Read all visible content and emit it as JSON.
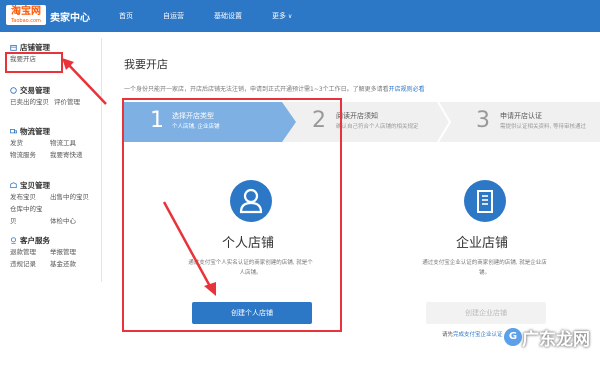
{
  "header": {
    "logo_main": "淘宝网",
    "logo_sub": "Taobao.com",
    "seller_center": "卖家中心",
    "nav": [
      "首页",
      "自运营",
      "基础设置",
      "更多"
    ]
  },
  "sidebar": {
    "groups": [
      {
        "title": "店铺管理",
        "icon": "store-icon",
        "links": [
          "我要开店"
        ]
      },
      {
        "title": "交易管理",
        "icon": "trade-icon",
        "links": [
          "已卖出的宝贝",
          "评价管理"
        ]
      },
      {
        "title": "物流管理",
        "icon": "truck-icon",
        "links": [
          "发货",
          "物流工具",
          "物流服务",
          "我要寄快递"
        ]
      },
      {
        "title": "宝贝管理",
        "icon": "goods-icon",
        "links": [
          "发布宝贝",
          "出售中的宝贝",
          "仓库中的宝贝",
          "体检中心"
        ]
      },
      {
        "title": "客户服务",
        "icon": "service-icon",
        "links": [
          "退款管理",
          "举报管理",
          "违规记录",
          "基金还款"
        ]
      }
    ]
  },
  "main": {
    "title": "我要开店",
    "tip_text": "一个身份只能开一家店，开店后店铺无法注销，申请到正式开通预计需1~3个工作日。了解更多请看",
    "tip_link": "开店规则必看",
    "steps": [
      {
        "num": "1",
        "title": "选择开店类型",
        "desc": "个人店铺, 企业店铺"
      },
      {
        "num": "2",
        "title": "阅读开店须知",
        "desc": "确认自己符合个人店铺的相关规定"
      },
      {
        "num": "3",
        "title": "申请开店认证",
        "desc": "需提供认证相关资料, 等待审核通过"
      }
    ],
    "cards": [
      {
        "title": "个人店铺",
        "desc": "通过支付宝个人实名认证的商家创建的店铺, 就是个人店铺。",
        "button": "创建个人店铺"
      },
      {
        "title": "企业店铺",
        "desc": "通过支付宝企业认证的商家创建的店铺, 就是企业店铺。",
        "button": "创建企业店铺",
        "sub_text": "请先",
        "sub_link": "完成支付宝企业认证"
      }
    ]
  },
  "watermark": "广东龙网",
  "colors": {
    "brand_blue": "#2d77c7",
    "step_active": "#7eb0e4",
    "highlight_red": "#e8333a"
  }
}
